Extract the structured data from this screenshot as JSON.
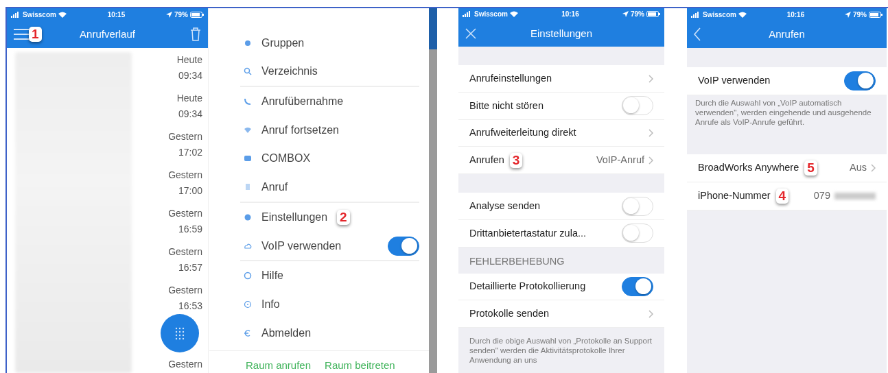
{
  "call_log": {
    "status": {
      "carrier": "Swisscom",
      "time": "10:15",
      "battery": "79%"
    },
    "title": "Anrufverlauf",
    "annotation": "1",
    "entries": [
      {
        "day": "Heute",
        "time": "09:34"
      },
      {
        "day": "Heute",
        "time": "09:34"
      },
      {
        "day": "Gestern",
        "time": "17:02"
      },
      {
        "day": "Gestern",
        "time": "17:00"
      },
      {
        "day": "Gestern",
        "time": "16:59"
      },
      {
        "day": "Gestern",
        "time": "16:57"
      },
      {
        "day": "Gestern",
        "time": "16:53"
      }
    ],
    "trailing_day": "Gestern"
  },
  "drawer": {
    "items": [
      {
        "label": "Gruppen",
        "divider_after": false,
        "kind": "link"
      },
      {
        "label": "Verzeichnis",
        "divider_after": true,
        "kind": "link"
      },
      {
        "label": "Anrufübernahme",
        "divider_after": false,
        "kind": "link"
      },
      {
        "label": "Anruf fortsetzen",
        "divider_after": false,
        "kind": "link"
      },
      {
        "label": "COMBOX",
        "divider_after": false,
        "kind": "link"
      },
      {
        "label": "Anruf",
        "divider_after": true,
        "kind": "link"
      },
      {
        "label": "Einstellungen",
        "divider_after": false,
        "kind": "link",
        "annotation": "2"
      },
      {
        "label": "VoIP verwenden",
        "divider_after": true,
        "kind": "toggle",
        "on": true
      },
      {
        "label": "Hilfe",
        "divider_after": false,
        "kind": "link"
      },
      {
        "label": "Info",
        "divider_after": false,
        "kind": "link"
      },
      {
        "label": "Abmelden",
        "divider_after": false,
        "kind": "link"
      }
    ],
    "footer_links": [
      "Raum anrufen",
      "Raum beitreten"
    ]
  },
  "settings": {
    "status": {
      "carrier": "Swisscom",
      "time": "10:16",
      "battery": "79%"
    },
    "title": "Einstellungen",
    "sections": [
      {
        "rows": [
          {
            "kind": "link",
            "label": "Anrufeinstellungen"
          },
          {
            "kind": "toggle",
            "label": "Bitte nicht stören",
            "on": false
          },
          {
            "kind": "link",
            "label": "Anrufweiterleitung direkt"
          },
          {
            "kind": "value",
            "label": "Anrufen",
            "value": "VoIP-Anruf",
            "annotation": "3"
          }
        ]
      },
      {
        "rows": [
          {
            "kind": "toggle",
            "label": "Analyse senden",
            "on": false
          },
          {
            "kind": "toggle",
            "label": "Drittanbietertastatur zula...",
            "on": false
          }
        ]
      },
      {
        "header": "FEHLERBEHEBUNG",
        "rows": [
          {
            "kind": "toggle",
            "label": "Detaillierte Protokollierung",
            "on": true
          },
          {
            "kind": "link",
            "label": "Protokolle senden"
          }
        ],
        "footer": "Durch die obige Auswahl von „Protokolle an Support senden\" werden die Aktivitätsprotokolle Ihrer Anwendung an uns"
      }
    ]
  },
  "calling": {
    "status": {
      "carrier": "Swisscom",
      "time": "10:16",
      "battery": "79%"
    },
    "title": "Anrufen",
    "sections": [
      {
        "rows": [
          {
            "kind": "toggle",
            "label": "VoIP verwenden",
            "on": true
          }
        ],
        "footer": "Durch die Auswahl von „VoIP automatisch verwenden\", werden eingehende und ausgehende Anrufe als VoIP-Anrufe geführt."
      },
      {
        "rows": [
          {
            "kind": "value",
            "label": "BroadWorks Anywhere",
            "value": "Aus",
            "annotation": "5"
          },
          {
            "kind": "number",
            "label": "iPhone-Nummer",
            "value": "079",
            "annotation": "4"
          }
        ]
      }
    ]
  }
}
